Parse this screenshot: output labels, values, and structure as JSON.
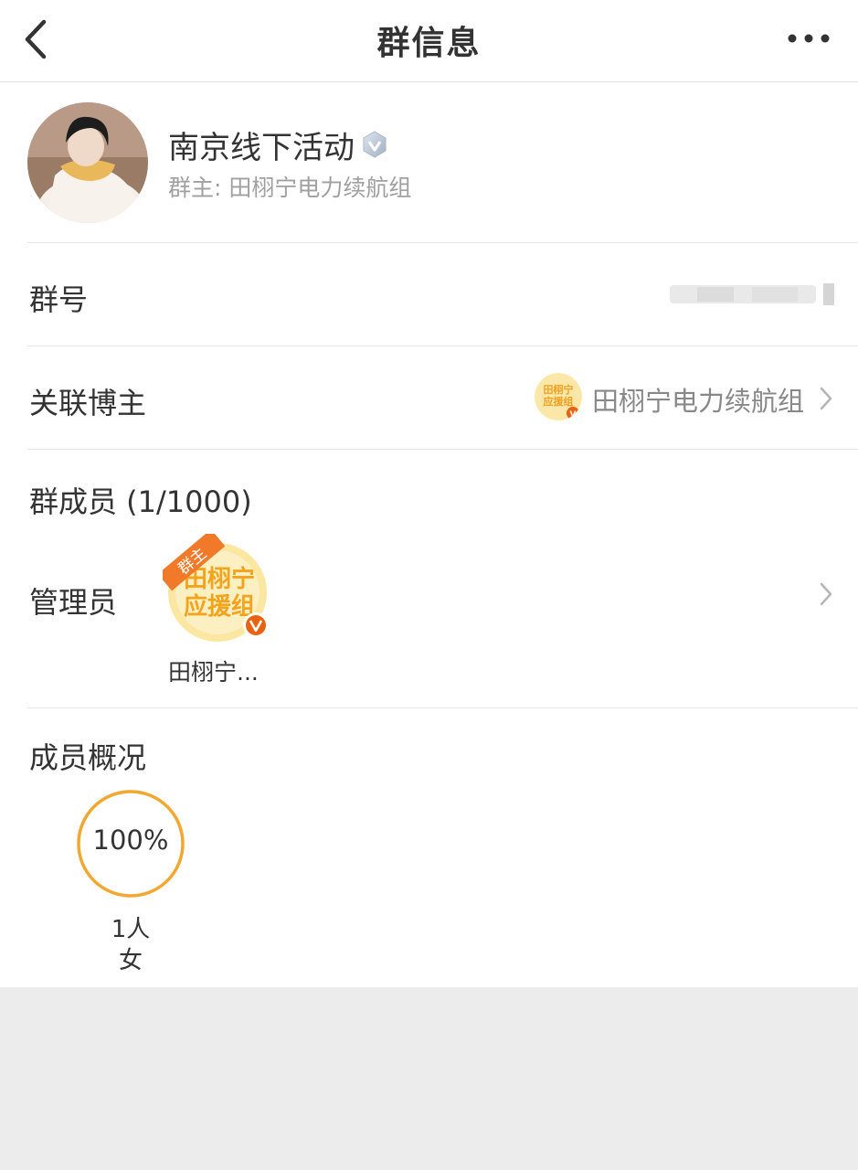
{
  "navbar": {
    "title": "群信息",
    "back_icon": "chevron-left-icon",
    "more_icon": "more-horizontal-icon"
  },
  "group": {
    "name": "南京线下活动",
    "owner": "群主: 田栩宁电力续航组",
    "verify_icon": "verified-badge-icon"
  },
  "rows": {
    "group_number_label": "群号",
    "linked_blogger_label": "关联博主",
    "linked_blogger_name": "田栩宁电力续航组",
    "members_label": "群成员 (1/1000)",
    "admin_label": "管理员",
    "admin_name": "田栩宁...",
    "owner_tag": "群主",
    "admin_avatar_text_line1": "田栩宁",
    "admin_avatar_text_line2": "应援组",
    "linked_avatar_text_line1": "田栩宁",
    "linked_avatar_text_line2": "应援组"
  },
  "overview": {
    "label": "成员概况",
    "percent": "100%",
    "count": "1人",
    "gender": "女"
  },
  "colors": {
    "accent_orange": "#f0a830",
    "tag_orange": "#f07a2a",
    "badge_orange": "#e8620f"
  }
}
